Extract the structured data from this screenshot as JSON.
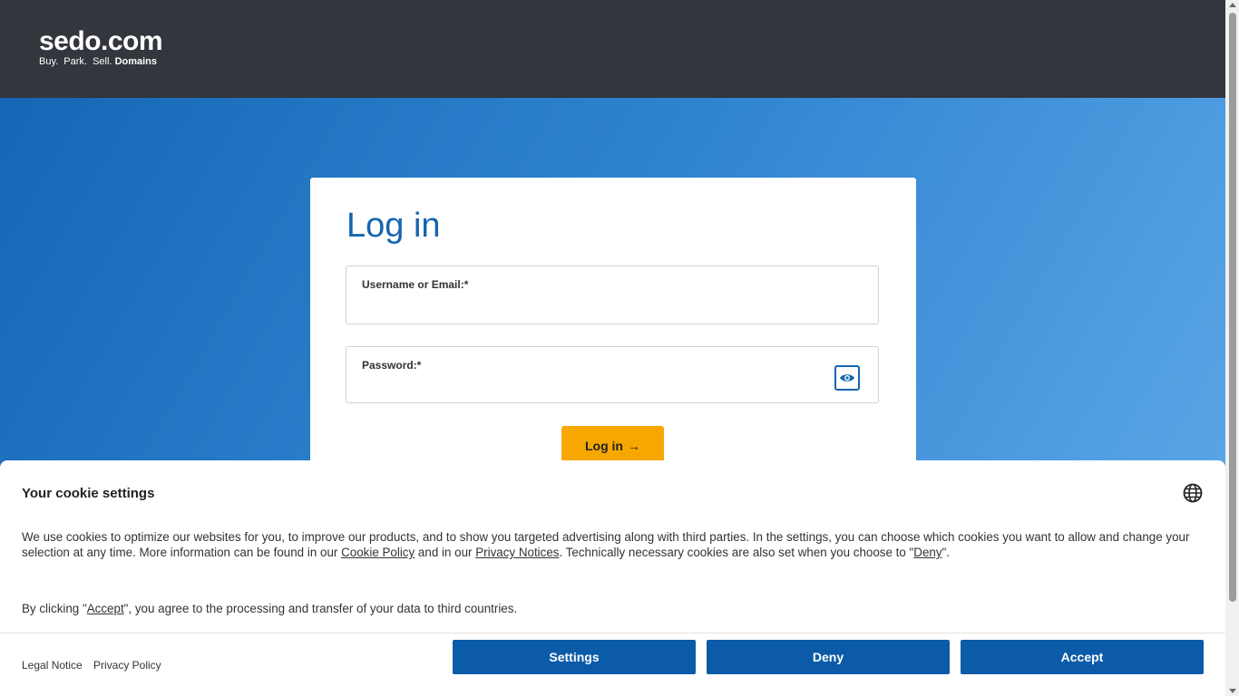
{
  "header": {
    "logo_name": "sedo.com",
    "logo_tag_plain": "Buy.  Park.  Sell. ",
    "logo_tag_bold": "Domains"
  },
  "login": {
    "title": "Log in",
    "username_label": "Username or Email:*",
    "username_value": "",
    "password_label": "Password:*",
    "password_value": "",
    "submit_label": "Log in",
    "submit_arrow": "→"
  },
  "cookie": {
    "title": "Your cookie settings",
    "text_part1": "We use cookies to optimize our websites for you, to improve our products, and to show you targeted advertising along with third parties. In the settings, you can choose which cookies you want to allow and change your selection at any time. More information can be found in our ",
    "cookie_policy_link": "Cookie Policy",
    "text_part2": " and in our ",
    "privacy_notices_link": "Privacy Notices",
    "text_part3": ". Technically necessary cookies are also set when you choose to \"",
    "deny_link": "Deny",
    "text_part4": "\".",
    "consent_part1": "By clicking \"",
    "accept_link": "Accept",
    "consent_part2": "\", you agree to the processing and transfer of your data to third countries.",
    "legal_notice": "Legal Notice",
    "privacy_policy": "Privacy Policy",
    "settings_button": "Settings",
    "deny_button": "Deny",
    "accept_button": "Accept"
  },
  "icons": {
    "eye": "eye-icon",
    "globe": "globe-icon"
  },
  "colors": {
    "header_bg": "#33363d",
    "brand_blue": "#1565b0",
    "button_blue": "#0b5ba8",
    "login_button": "#f7a800"
  }
}
